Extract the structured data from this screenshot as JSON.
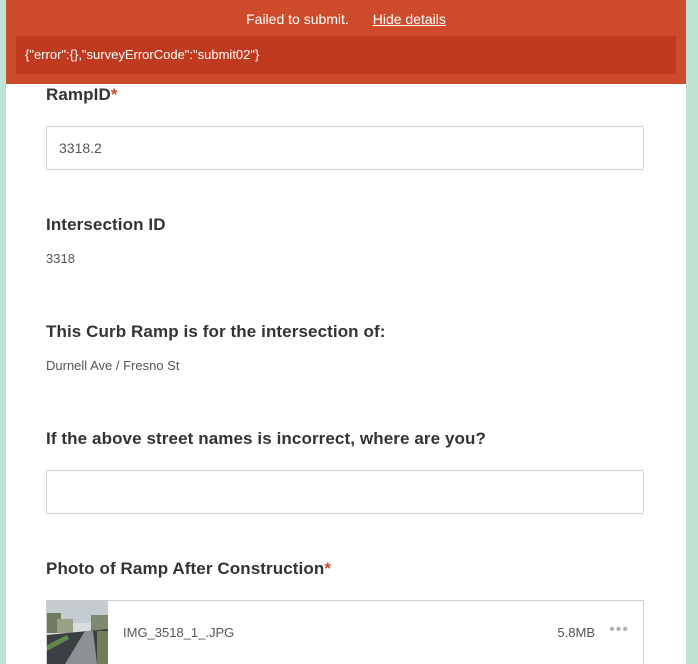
{
  "banner": {
    "message": "Failed to submit.",
    "toggle_label": "Hide details",
    "details": "{\"error\":{},\"surveyErrorCode\":\"submit02\"}",
    "color": "#cd4a2a"
  },
  "form": {
    "ramp_id": {
      "label": "RampID",
      "required_mark": "*",
      "value": "3318.2"
    },
    "intersection_id": {
      "label": "Intersection ID",
      "value": "3318"
    },
    "intersection_of": {
      "label": "This Curb Ramp is for the intersection of:",
      "value": "Durnell Ave / Fresno St"
    },
    "incorrect_street": {
      "label": "If the above street names is incorrect, where are you?",
      "value": ""
    },
    "photo_after": {
      "label": "Photo of Ramp After Construction",
      "required_mark": "*",
      "attachment": {
        "filename": "IMG_3518_1_.JPG",
        "size": "5.8MB",
        "more_icon": "more-horizontal-icon",
        "more_glyph": "•••"
      }
    }
  }
}
